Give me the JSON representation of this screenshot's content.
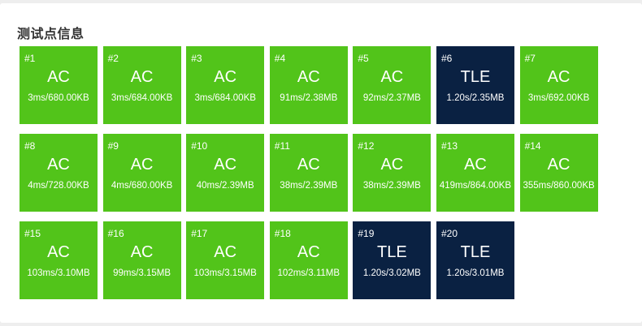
{
  "panel": {
    "title": "测试点信息"
  },
  "colors": {
    "ac": "#52c41a",
    "tle": "#0a2142"
  },
  "testcases": [
    {
      "id": "#1",
      "status": "AC",
      "stats": "3ms/680.00KB"
    },
    {
      "id": "#2",
      "status": "AC",
      "stats": "3ms/684.00KB"
    },
    {
      "id": "#3",
      "status": "AC",
      "stats": "3ms/684.00KB"
    },
    {
      "id": "#4",
      "status": "AC",
      "stats": "91ms/2.38MB"
    },
    {
      "id": "#5",
      "status": "AC",
      "stats": "92ms/2.37MB"
    },
    {
      "id": "#6",
      "status": "TLE",
      "stats": "1.20s/2.35MB"
    },
    {
      "id": "#7",
      "status": "AC",
      "stats": "3ms/692.00KB"
    },
    {
      "id": "#8",
      "status": "AC",
      "stats": "4ms/728.00KB"
    },
    {
      "id": "#9",
      "status": "AC",
      "stats": "4ms/680.00KB"
    },
    {
      "id": "#10",
      "status": "AC",
      "stats": "40ms/2.39MB"
    },
    {
      "id": "#11",
      "status": "AC",
      "stats": "38ms/2.39MB"
    },
    {
      "id": "#12",
      "status": "AC",
      "stats": "38ms/2.39MB"
    },
    {
      "id": "#13",
      "status": "AC",
      "stats": "419ms/864.00KB"
    },
    {
      "id": "#14",
      "status": "AC",
      "stats": "355ms/860.00KB"
    },
    {
      "id": "#15",
      "status": "AC",
      "stats": "103ms/3.10MB"
    },
    {
      "id": "#16",
      "status": "AC",
      "stats": "99ms/3.15MB"
    },
    {
      "id": "#17",
      "status": "AC",
      "stats": "103ms/3.15MB"
    },
    {
      "id": "#18",
      "status": "AC",
      "stats": "102ms/3.11MB"
    },
    {
      "id": "#19",
      "status": "TLE",
      "stats": "1.20s/3.02MB"
    },
    {
      "id": "#20",
      "status": "TLE",
      "stats": "1.20s/3.01MB"
    }
  ]
}
